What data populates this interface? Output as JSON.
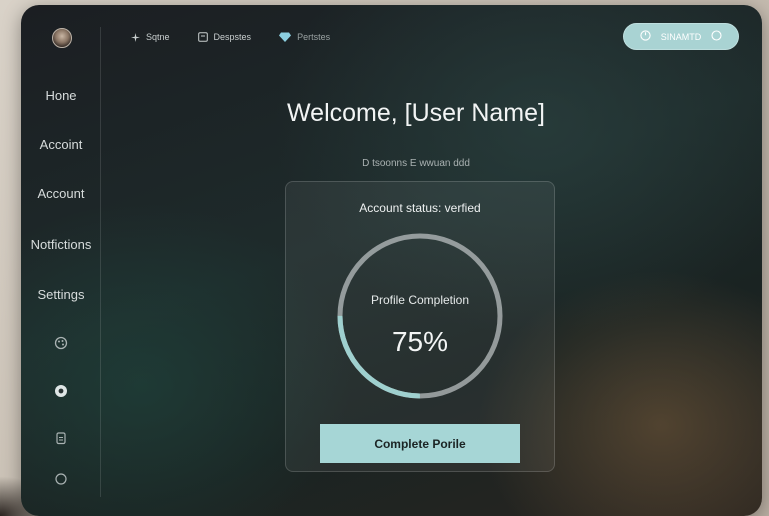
{
  "topnav": {
    "items": [
      {
        "label": "Sqtne",
        "icon": "sparkle-icon"
      },
      {
        "label": "Despstes",
        "icon": "document-icon"
      },
      {
        "label": "Pertstes",
        "icon": "diamond-icon"
      }
    ],
    "pill": {
      "label": "SINAMTD",
      "icon_left": "power-icon",
      "icon_right": "circle-icon"
    }
  },
  "sidebar": {
    "avatar": "avatar",
    "items": [
      {
        "label": "Hone"
      },
      {
        "label": "Accoint"
      },
      {
        "label": "Account"
      },
      {
        "label": "Notfictions"
      },
      {
        "label": "Settings"
      }
    ],
    "icons": [
      "palette-icon",
      "record-icon",
      "clipboard-icon",
      "circle-icon"
    ]
  },
  "main": {
    "title": "Welcome, [User Name]",
    "subtitle": "D tsoonns E wwuan ddd"
  },
  "card": {
    "status": "Account status: verfied",
    "progress_label": "Profile Completion",
    "progress_value": 75,
    "progress_text": "75%",
    "button_label": "Complete Porile"
  },
  "colors": {
    "accent": "#a6d6d6",
    "ring_track": "#b8bdbf",
    "ring_fill": "#9fd0cf"
  }
}
